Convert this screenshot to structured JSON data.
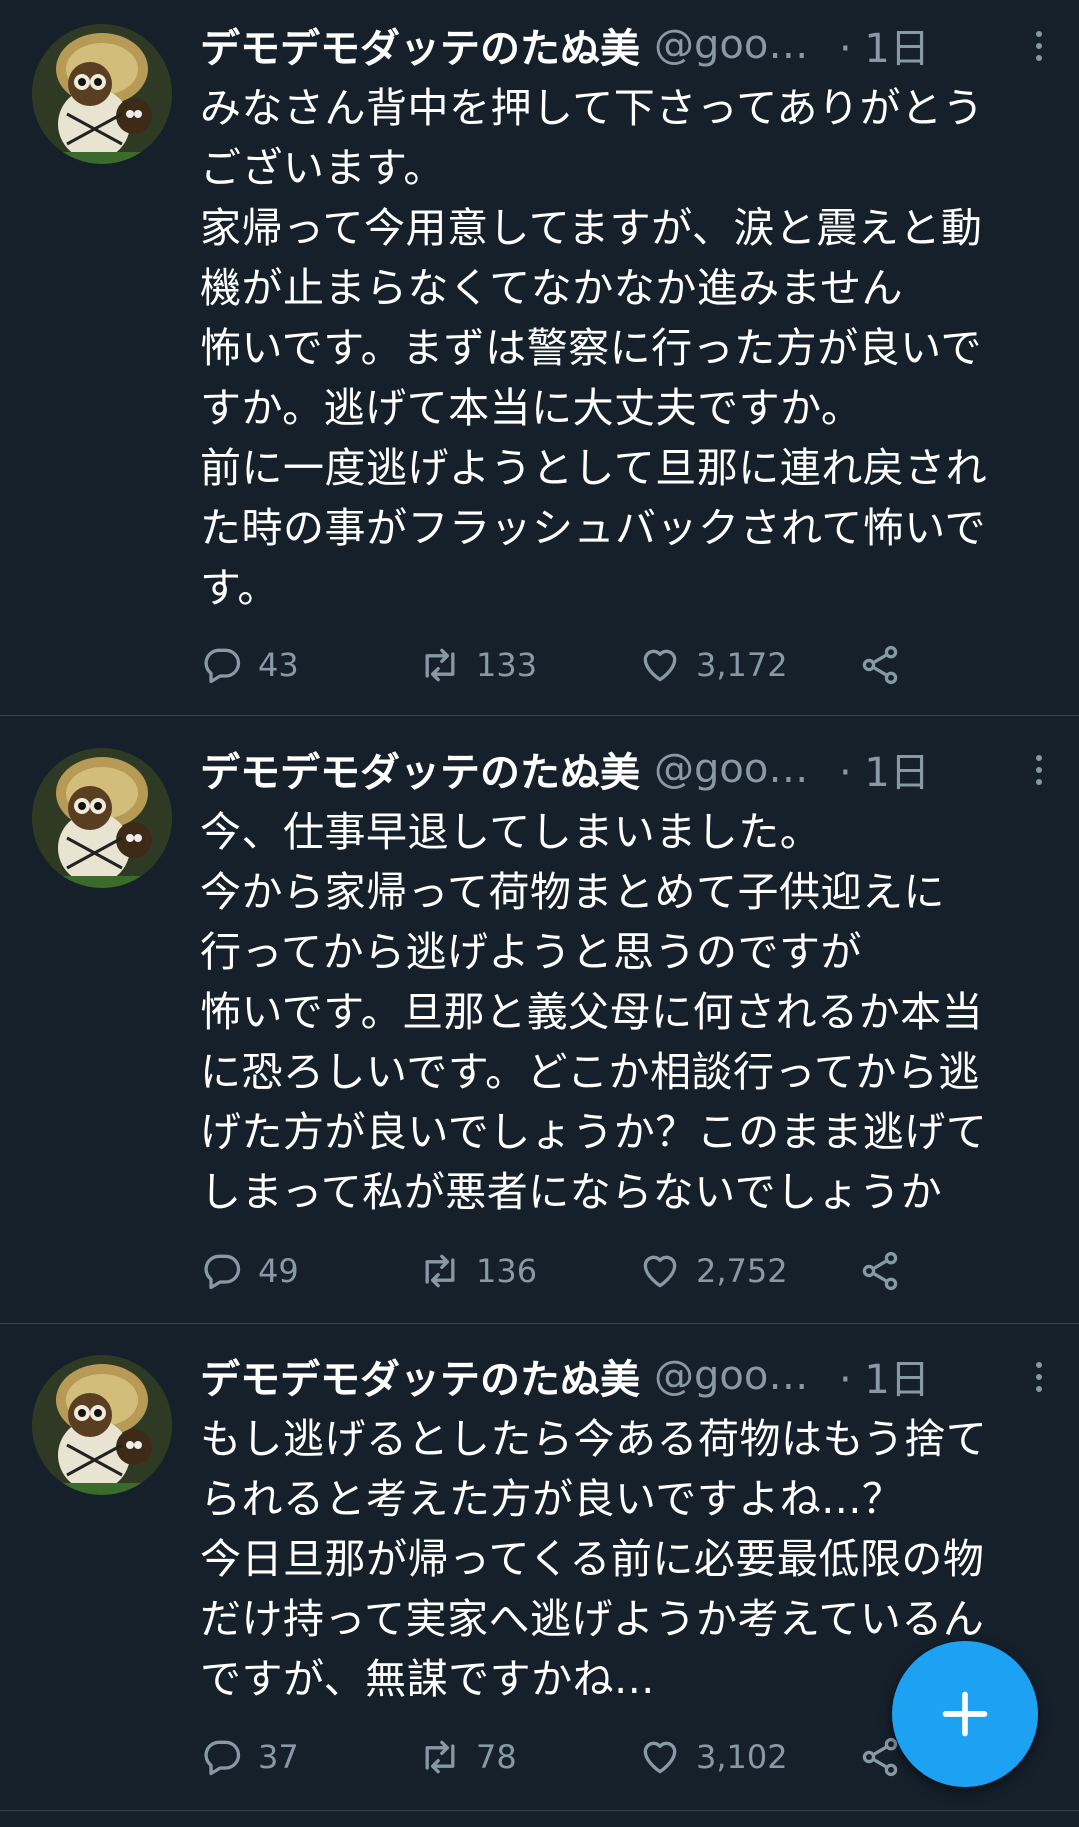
{
  "tweets": [
    {
      "name": "デモデモダッテのたぬ美",
      "handle": "@good...",
      "time": "· 1日",
      "lines": [
        "みなさん背中を押して下さってありがとう",
        "ございます。",
        "家帰って今用意してますが、涙と震えと動",
        "機が止まらなくてなかなか進みません",
        "怖いです。まずは警察に行った方が良いで",
        "すか。逃げて本当に大丈夫ですか。",
        "前に一度逃げようとして旦那に連れ戻され",
        "た時の事がフラッシュバックされて怖いで",
        "す。"
      ],
      "replies": "43",
      "retweets": "133",
      "likes": "3,172"
    },
    {
      "name": "デモデモダッテのたぬ美",
      "handle": "@good...",
      "time": "· 1日",
      "lines": [
        "今、仕事早退してしまいました。",
        "今から家帰って荷物まとめて子供迎えに",
        "行ってから逃げようと思うのですが",
        "怖いです。旦那と義父母に何されるか本当",
        "に恐ろしいです。どこか相談行ってから逃",
        "げた方が良いでしょうか？このまま逃げて",
        "しまって私が悪者にならないでしょうか"
      ],
      "replies": "49",
      "retweets": "136",
      "likes": "2,752"
    },
    {
      "name": "デモデモダッテのたぬ美",
      "handle": "@good...",
      "time": "· 1日",
      "lines": [
        "もし逃げるとしたら今ある荷物はもう捨て",
        "られると考えた方が良いですよね...？",
        "今日旦那が帰ってくる前に必要最低限の物",
        "だけ持って実家へ逃げようか考えているん",
        "ですが、無謀ですかね..."
      ],
      "replies": "37",
      "retweets": "78",
      "likes": "3,102"
    }
  ],
  "colors": {
    "background": "#15202b",
    "secondary_text": "#8899a6",
    "accent": "#1da1f2",
    "divider": "#38444d"
  },
  "icons": [
    "tanuki-avatar",
    "more-vertical-icon",
    "reply-icon",
    "retweet-icon",
    "like-icon",
    "share-icon",
    "compose-plus-icon"
  ]
}
